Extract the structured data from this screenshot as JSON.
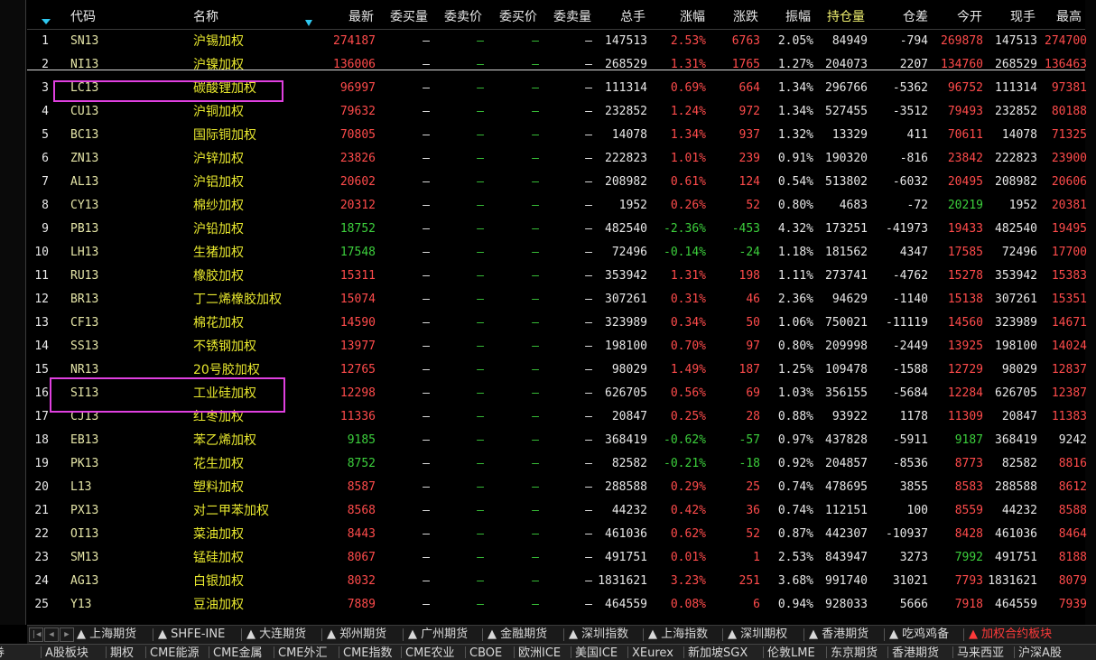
{
  "columns": [
    "代码",
    "名称",
    "最新",
    "委买量",
    "委卖价",
    "委买价",
    "委卖量",
    "总手",
    "涨幅",
    "涨跌",
    "振幅",
    "持仓量",
    "仓差",
    "今开",
    "现手",
    "最高"
  ],
  "rows": [
    {
      "idx": "1",
      "code": "SN13",
      "name": "沪锡加权",
      "last": "274187",
      "total": "147513",
      "chgp": "2.53%",
      "chg": "6763",
      "amp": "2.05%",
      "oi": "84949",
      "oid": "-794",
      "open": "269878",
      "cur": "147513",
      "high": "274700",
      "lc": "red",
      "oc": "red",
      "hc": "red",
      "cc": "red"
    },
    {
      "idx": "2",
      "code": "NI13",
      "name": "沪镍加权",
      "last": "136006",
      "total": "268529",
      "chgp": "1.31%",
      "chg": "1765",
      "amp": "1.27%",
      "oi": "204073",
      "oid": "2207",
      "open": "134760",
      "cur": "268529",
      "high": "136463",
      "lc": "red",
      "oc": "red",
      "hc": "red",
      "cc": "red"
    },
    {
      "idx": "3",
      "code": "LC13",
      "name": "碳酸锂加权",
      "last": "96997",
      "total": "111314",
      "chgp": "0.69%",
      "chg": "664",
      "amp": "1.34%",
      "oi": "296766",
      "oid": "-5362",
      "open": "96752",
      "cur": "111314",
      "high": "97381",
      "lc": "red",
      "oc": "red",
      "hc": "red",
      "cc": "red"
    },
    {
      "idx": "4",
      "code": "CU13",
      "name": "沪铜加权",
      "last": "79632",
      "total": "232852",
      "chgp": "1.24%",
      "chg": "972",
      "amp": "1.34%",
      "oi": "527455",
      "oid": "-3512",
      "open": "79493",
      "cur": "232852",
      "high": "80188",
      "lc": "red",
      "oc": "red",
      "hc": "red",
      "cc": "red"
    },
    {
      "idx": "5",
      "code": "BC13",
      "name": "国际铜加权",
      "last": "70805",
      "total": "14078",
      "chgp": "1.34%",
      "chg": "937",
      "amp": "1.32%",
      "oi": "13329",
      "oid": "411",
      "open": "70611",
      "cur": "14078",
      "high": "71325",
      "lc": "red",
      "oc": "red",
      "hc": "red",
      "cc": "red"
    },
    {
      "idx": "6",
      "code": "ZN13",
      "name": "沪锌加权",
      "last": "23826",
      "total": "222823",
      "chgp": "1.01%",
      "chg": "239",
      "amp": "0.91%",
      "oi": "190320",
      "oid": "-816",
      "open": "23842",
      "cur": "222823",
      "high": "23900",
      "lc": "red",
      "oc": "red",
      "hc": "red",
      "cc": "red"
    },
    {
      "idx": "7",
      "code": "AL13",
      "name": "沪铝加权",
      "last": "20602",
      "total": "208982",
      "chgp": "0.61%",
      "chg": "124",
      "amp": "0.54%",
      "oi": "513802",
      "oid": "-6032",
      "open": "20495",
      "cur": "208982",
      "high": "20606",
      "lc": "red",
      "oc": "red",
      "hc": "red",
      "cc": "red"
    },
    {
      "idx": "8",
      "code": "CY13",
      "name": "棉纱加权",
      "last": "20312",
      "total": "1952",
      "chgp": "0.26%",
      "chg": "52",
      "amp": "0.80%",
      "oi": "4683",
      "oid": "-72",
      "open": "20219",
      "cur": "1952",
      "high": "20381",
      "lc": "red",
      "oc": "green",
      "hc": "red",
      "cc": "red"
    },
    {
      "idx": "9",
      "code": "PB13",
      "name": "沪铅加权",
      "last": "18752",
      "total": "482540",
      "chgp": "-2.36%",
      "chg": "-453",
      "amp": "4.32%",
      "oi": "173251",
      "oid": "-41973",
      "open": "19433",
      "cur": "482540",
      "high": "19495",
      "lc": "green",
      "oc": "red",
      "hc": "red",
      "cc": "green"
    },
    {
      "idx": "10",
      "code": "LH13",
      "name": "生猪加权",
      "last": "17548",
      "total": "72496",
      "chgp": "-0.14%",
      "chg": "-24",
      "amp": "1.18%",
      "oi": "181562",
      "oid": "4347",
      "open": "17585",
      "cur": "72496",
      "high": "17700",
      "lc": "green",
      "oc": "red",
      "hc": "red",
      "cc": "green"
    },
    {
      "idx": "11",
      "code": "RU13",
      "name": "橡胶加权",
      "last": "15311",
      "total": "353942",
      "chgp": "1.31%",
      "chg": "198",
      "amp": "1.11%",
      "oi": "273741",
      "oid": "-4762",
      "open": "15278",
      "cur": "353942",
      "high": "15383",
      "lc": "red",
      "oc": "red",
      "hc": "red",
      "cc": "red"
    },
    {
      "idx": "12",
      "code": "BR13",
      "name": "丁二烯橡胶加权",
      "last": "15074",
      "total": "307261",
      "chgp": "0.31%",
      "chg": "46",
      "amp": "2.36%",
      "oi": "94629",
      "oid": "-1140",
      "open": "15138",
      "cur": "307261",
      "high": "15351",
      "lc": "red",
      "oc": "red",
      "hc": "red",
      "cc": "red"
    },
    {
      "idx": "13",
      "code": "CF13",
      "name": "棉花加权",
      "last": "14590",
      "total": "323989",
      "chgp": "0.34%",
      "chg": "50",
      "amp": "1.06%",
      "oi": "750021",
      "oid": "-11119",
      "open": "14560",
      "cur": "323989",
      "high": "14671",
      "lc": "red",
      "oc": "red",
      "hc": "red",
      "cc": "red"
    },
    {
      "idx": "14",
      "code": "SS13",
      "name": "不锈钢加权",
      "last": "13977",
      "total": "198100",
      "chgp": "0.70%",
      "chg": "97",
      "amp": "0.80%",
      "oi": "209998",
      "oid": "-2449",
      "open": "13925",
      "cur": "198100",
      "high": "14024",
      "lc": "red",
      "oc": "red",
      "hc": "red",
      "cc": "red"
    },
    {
      "idx": "15",
      "code": "NR13",
      "name": "20号胶加权",
      "last": "12765",
      "total": "98029",
      "chgp": "1.49%",
      "chg": "187",
      "amp": "1.25%",
      "oi": "109478",
      "oid": "-1588",
      "open": "12729",
      "cur": "98029",
      "high": "12837",
      "lc": "red",
      "oc": "red",
      "hc": "red",
      "cc": "red"
    },
    {
      "idx": "16",
      "code": "SI13",
      "name": "工业硅加权",
      "last": "12298",
      "total": "626705",
      "chgp": "0.56%",
      "chg": "69",
      "amp": "1.03%",
      "oi": "356155",
      "oid": "-5684",
      "open": "12284",
      "cur": "626705",
      "high": "12387",
      "lc": "red",
      "oc": "red",
      "hc": "red",
      "cc": "red"
    },
    {
      "idx": "17",
      "code": "CJ13",
      "name": "红枣加权",
      "last": "11336",
      "total": "20847",
      "chgp": "0.25%",
      "chg": "28",
      "amp": "0.88%",
      "oi": "93922",
      "oid": "1178",
      "open": "11309",
      "cur": "20847",
      "high": "11383",
      "lc": "red",
      "oc": "red",
      "hc": "red",
      "cc": "red"
    },
    {
      "idx": "18",
      "code": "EB13",
      "name": "苯乙烯加权",
      "last": "9185",
      "total": "368419",
      "chgp": "-0.62%",
      "chg": "-57",
      "amp": "0.97%",
      "oi": "437828",
      "oid": "-5911",
      "open": "9187",
      "cur": "368419",
      "high": "9242",
      "lc": "green",
      "oc": "green",
      "hc": "white",
      "cc": "green"
    },
    {
      "idx": "19",
      "code": "PK13",
      "name": "花生加权",
      "last": "8752",
      "total": "82582",
      "chgp": "-0.21%",
      "chg": "-18",
      "amp": "0.92%",
      "oi": "204857",
      "oid": "-8536",
      "open": "8773",
      "cur": "82582",
      "high": "8816",
      "lc": "green",
      "oc": "red",
      "hc": "red",
      "cc": "green"
    },
    {
      "idx": "20",
      "code": "L13",
      "name": "塑料加权",
      "last": "8587",
      "total": "288588",
      "chgp": "0.29%",
      "chg": "25",
      "amp": "0.74%",
      "oi": "478695",
      "oid": "3855",
      "open": "8583",
      "cur": "288588",
      "high": "8612",
      "lc": "red",
      "oc": "red",
      "hc": "red",
      "cc": "red"
    },
    {
      "idx": "21",
      "code": "PX13",
      "name": "对二甲苯加权",
      "last": "8568",
      "total": "44232",
      "chgp": "0.42%",
      "chg": "36",
      "amp": "0.74%",
      "oi": "112151",
      "oid": "100",
      "open": "8559",
      "cur": "44232",
      "high": "8588",
      "lc": "red",
      "oc": "red",
      "hc": "red",
      "cc": "red"
    },
    {
      "idx": "22",
      "code": "OI13",
      "name": "菜油加权",
      "last": "8443",
      "total": "461036",
      "chgp": "0.62%",
      "chg": "52",
      "amp": "0.87%",
      "oi": "442307",
      "oid": "-10937",
      "open": "8428",
      "cur": "461036",
      "high": "8464",
      "lc": "red",
      "oc": "red",
      "hc": "red",
      "cc": "red"
    },
    {
      "idx": "23",
      "code": "SM13",
      "name": "锰硅加权",
      "last": "8067",
      "total": "491751",
      "chgp": "0.01%",
      "chg": "1",
      "amp": "2.53%",
      "oi": "843947",
      "oid": "3273",
      "open": "7992",
      "cur": "491751",
      "high": "8188",
      "lc": "red",
      "oc": "green",
      "hc": "red",
      "cc": "red"
    },
    {
      "idx": "24",
      "code": "AG13",
      "name": "白银加权",
      "last": "8032",
      "total": "1831621",
      "chgp": "3.23%",
      "chg": "251",
      "amp": "3.68%",
      "oi": "991740",
      "oid": "31021",
      "open": "7793",
      "cur": "1831621",
      "high": "8079",
      "lc": "red",
      "oc": "red",
      "hc": "red",
      "cc": "red"
    },
    {
      "idx": "25",
      "code": "Y13",
      "name": "豆油加权",
      "last": "7889",
      "total": "464559",
      "chgp": "0.08%",
      "chg": "6",
      "amp": "0.94%",
      "oi": "928033",
      "oid": "5666",
      "open": "7918",
      "cur": "464559",
      "high": "7939",
      "lc": "red",
      "oc": "red",
      "hc": "red",
      "cc": "red"
    }
  ],
  "dash": "—",
  "tabs": [
    "上海期货",
    "SHFE-INE",
    "大连期货",
    "郑州期货",
    "广州期货",
    "金融期货",
    "深圳指数",
    "上海指数",
    "深圳期权",
    "香港期货",
    "吃鸡鸡备",
    "加权合约板块"
  ],
  "bottom_tabs": [
    "券",
    "A股板块",
    "期权",
    "CME能源",
    "CME金属",
    "CME外汇",
    "CME指数",
    "CME农业",
    "CBOE",
    "欧洲ICE",
    "美国ICE",
    "XEurex",
    "新加坡SGX",
    "伦敦LME",
    "东京期货",
    "香港期货",
    "马来西亚",
    "沪深A股"
  ],
  "colors": {
    "red": "#ff4b4b",
    "green": "#3ccf3c",
    "yellow": "#e8e82e",
    "highlight_box": "#e040e0",
    "header_accent": "#2ec8f0"
  }
}
